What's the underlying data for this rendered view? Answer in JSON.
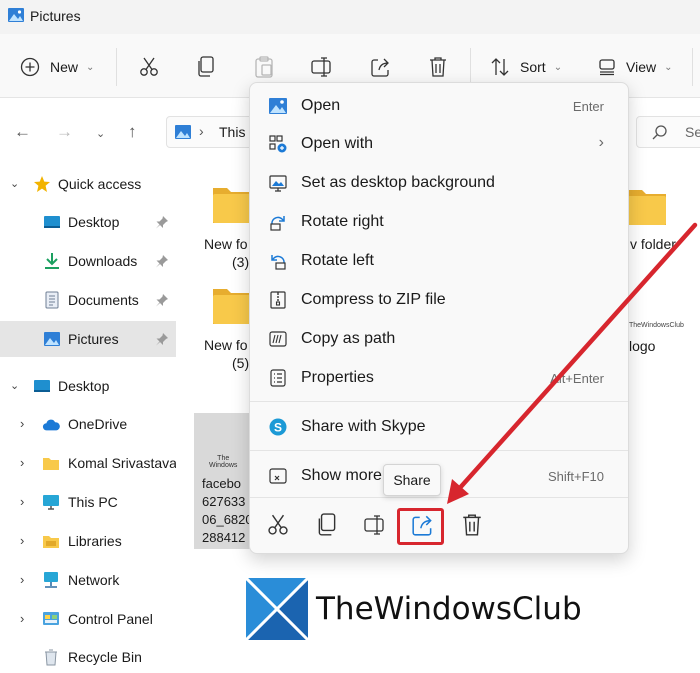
{
  "window": {
    "title": "Pictures"
  },
  "toolbar": {
    "new_label": "New",
    "sort_label": "Sort",
    "view_label": "View"
  },
  "address": {
    "crumb": "This",
    "search_placeholder": "Se"
  },
  "sidebar": {
    "items": [
      {
        "label": "Quick access"
      },
      {
        "label": "Desktop"
      },
      {
        "label": "Downloads"
      },
      {
        "label": "Documents"
      },
      {
        "label": "Pictures"
      },
      {
        "label": "Desktop"
      },
      {
        "label": "OneDrive"
      },
      {
        "label": "Komal Srivastava"
      },
      {
        "label": "This PC"
      },
      {
        "label": "Libraries"
      },
      {
        "label": "Network"
      },
      {
        "label": "Control Panel"
      },
      {
        "label": "Recycle Bin"
      }
    ]
  },
  "content": {
    "folder1": {
      "line1": "New fo",
      "line2": "(3)"
    },
    "folder2": {
      "line1": "New fo",
      "line2": "(5)"
    },
    "folder3": {
      "line1": "v folder"
    },
    "logo_file": {
      "label": "logo"
    },
    "thumb_file": {
      "lines": [
        "facebo",
        "627633",
        "06_6820",
        "288412"
      ]
    }
  },
  "context_menu": {
    "items": [
      {
        "label": "Open",
        "shortcut": "Enter"
      },
      {
        "label": "Open with"
      },
      {
        "label": "Set as desktop background"
      },
      {
        "label": "Rotate right"
      },
      {
        "label": "Rotate left"
      },
      {
        "label": "Compress to ZIP file"
      },
      {
        "label": "Copy as path"
      },
      {
        "label": "Properties",
        "shortcut": "Alt+Enter"
      },
      {
        "label": "Share with Skype"
      },
      {
        "label": "Show more options",
        "shortcut": "Shift+F10"
      }
    ],
    "tooltip": "Share"
  },
  "watermark": {
    "text": "TheWindowsClub"
  },
  "colors": {
    "accent": "#0067c0",
    "folder": "#f8c94a",
    "highlight": "#d7262e"
  }
}
